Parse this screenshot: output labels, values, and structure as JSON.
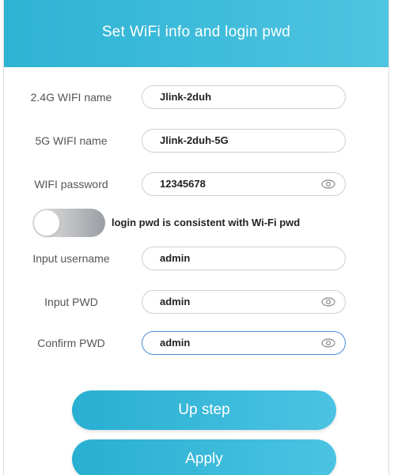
{
  "header": {
    "title": "Set WiFi info and login pwd"
  },
  "fields": [
    {
      "label": "2.4G WIFI name",
      "value": "Jlink-2duh"
    },
    {
      "label": "5G WIFI name",
      "value": "Jlink-2duh-5G"
    },
    {
      "label": "WIFI password",
      "value": "12345678"
    },
    {
      "label": "Input username",
      "value": "admin"
    },
    {
      "label": "Input PWD",
      "value": "admin"
    },
    {
      "label": "Confirm PWD",
      "value": "admin"
    }
  ],
  "toggle": {
    "label": "login pwd is consistent with Wi-Fi pwd",
    "state": "off"
  },
  "buttons": {
    "up_step": "Up step",
    "apply": "Apply"
  },
  "colors": {
    "accent": "#2eb3d4",
    "focus": "#4a8fd6"
  },
  "icons": {
    "password_visibility": "eye-icon"
  }
}
